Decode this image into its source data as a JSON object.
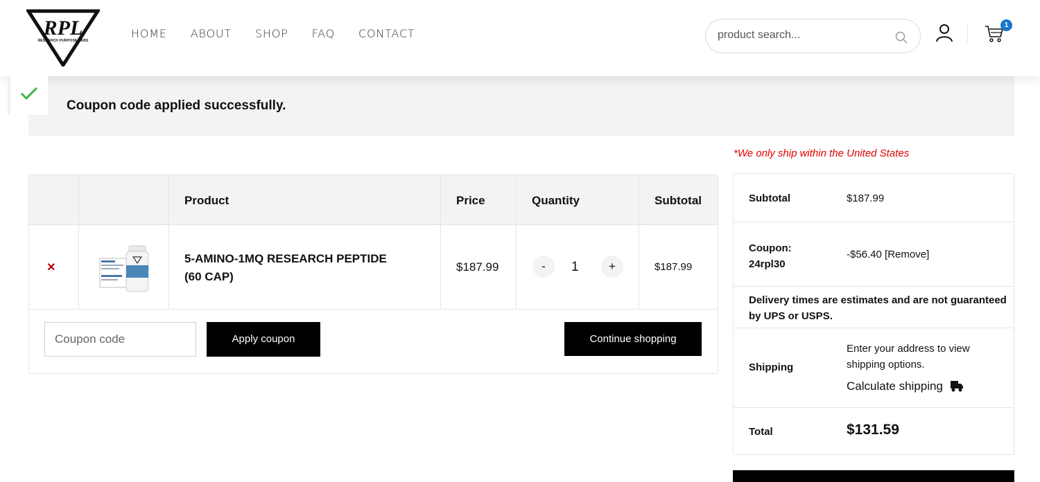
{
  "header": {
    "logo_text": "RPL",
    "logo_subtext": "RESEARCH PURPOSE LABS",
    "nav": [
      "HOME",
      "ABOUT",
      "SHOP",
      "FAQ",
      "CONTACT"
    ],
    "search_placeholder": "product search...",
    "cart_count": "1",
    "icons": [
      "search-icon",
      "user-icon",
      "cart-icon"
    ]
  },
  "notice": {
    "text": "Coupon code applied successfully.",
    "icon": "check-icon",
    "check_color": "#3cb34a"
  },
  "ship_note": "*We only ship within the United States",
  "cart": {
    "columns": [
      "Product",
      "Price",
      "Quantity",
      "Subtotal"
    ],
    "items": [
      {
        "remove": "×",
        "name_line1": "5-AMINO-1MQ RESEARCH PEPTIDE",
        "name_line2": "(60 CAP)",
        "price": "$187.99",
        "qty_minus": "-",
        "qty": "1",
        "qty_plus": "+",
        "subtotal": "$187.99"
      }
    ],
    "coupon_placeholder": "Coupon code",
    "apply_label": "Apply coupon",
    "continue_label": "Continue shopping"
  },
  "totals": {
    "subtotal_label": "Subtotal",
    "subtotal_value": "$187.99",
    "coupon_label_1": "Coupon:",
    "coupon_label_2": "24rpl30",
    "coupon_value": "-$56.40",
    "coupon_remove": "[Remove]",
    "delivery_line1": "Delivery times are estimates and are not guaranteed",
    "delivery_line2": "by UPS or USPS.",
    "shipping_label": "Shipping",
    "shipping_text_1": "Enter your address to view",
    "shipping_text_2": "shipping options.",
    "calc_shipping": "Calculate shipping",
    "total_label": "Total",
    "total_value": "$131.59"
  },
  "colors": {
    "accent_red": "#e00000",
    "remove_red": "#b20000",
    "badge_blue": "#1a77c9",
    "button_black": "#000000"
  }
}
